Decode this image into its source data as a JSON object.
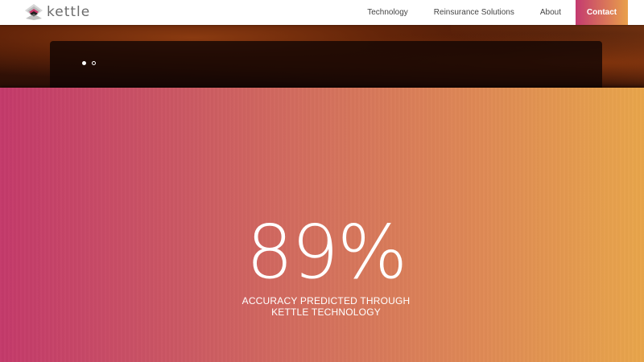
{
  "header": {
    "logo_text": "kettle",
    "logo_icon": "kettle-logo-icon",
    "nav": [
      {
        "label": "Technology"
      },
      {
        "label": "Reinsurance Solutions"
      },
      {
        "label": "About"
      }
    ],
    "contact_label": "Contact"
  },
  "hero": {
    "carousel": {
      "slide_count": 2,
      "active_index": 0
    }
  },
  "stat": {
    "value": "89%",
    "caption_line1": "ACCURACY PREDICTED THROUGH",
    "caption_line2": "KETTLE TECHNOLOGY"
  },
  "colors": {
    "gradient_start": "#c43a6b",
    "gradient_end": "#e9a64b",
    "header_bg": "#ffffff",
    "nav_text": "#444444"
  }
}
